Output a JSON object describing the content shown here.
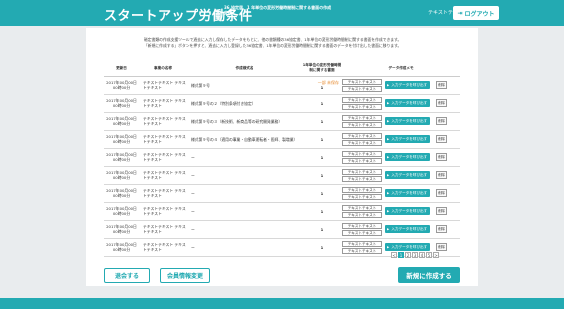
{
  "header": {
    "title": "スタートアップ労働条件",
    "subtitle": "36 協定届、1 年単位の変形労働時間制に関する書面の作成支援",
    "user_name": "テキストテキ",
    "logout_label": "ログアウト"
  },
  "description": {
    "line1": "磁定書類の作成支援ツールで過去に入力し保存したデータをもとに、他の書類種の36協定書、1年単位の変形労働時間制に関する書面を作成できます。",
    "line2": "「新規に作成する」ボタンを押すと、過去に入力し登録した36協定書、1年単位の変形労働時間制に関する書面のデータを付け出した書面に移ります。"
  },
  "table": {
    "headers": {
      "date": "更新日",
      "name": "事業の名称",
      "law": "作成様式名",
      "count": "1年単位の変形労働時間制に関する書面",
      "data_create": "データ作成メモ"
    },
    "rows": [
      {
        "date": "2017年00月00日 00時00分",
        "name": "テキストテキスト テキストテキスト",
        "law": "様式第９号",
        "remain": "一部 未保存",
        "count": "1",
        "seg1": "テキストテキスト",
        "seg2": "テキストテキスト",
        "input": "入力データを呼び出す",
        "del": "削除"
      },
      {
        "date": "2017年00月00日 00時00分",
        "name": "テキストテキスト テキストテキスト",
        "law": "様式第９号の２（特別条項付き協定）",
        "remain": "",
        "count": "1",
        "seg1": "テキストテキスト",
        "seg2": "テキストテキスト",
        "input": "入力データを呼び出す",
        "del": "削除"
      },
      {
        "date": "2017年00月00日 00時00分",
        "name": "テキストテキスト テキストテキスト",
        "law": "様式第９号の３（新技術、新商品等の研究開発業務）",
        "remain": "",
        "count": "1",
        "seg1": "テキストテキスト",
        "seg2": "テキストテキスト",
        "input": "入力データを呼び出す",
        "del": "削除"
      },
      {
        "date": "2017年00月00日 00時00分",
        "name": "テキストテキスト テキストテキスト",
        "law": "様式第９号の４（適用の事業・自動車運転者・医師、製増業）",
        "remain": "",
        "count": "1",
        "seg1": "テキストテキスト",
        "seg2": "テキストテキスト",
        "input": "入力データを呼び出す",
        "del": "削除"
      },
      {
        "date": "2017年00月00日 00時00分",
        "name": "テキストテキスト テキストテキスト",
        "law": "ー",
        "remain": "",
        "count": "1",
        "seg1": "テキストテキスト",
        "seg2": "テキストテキスト",
        "input": "入力データを呼び出す",
        "del": "削除"
      },
      {
        "date": "2017年00月00日 00時00分",
        "name": "テキストテキスト テキストテキスト",
        "law": "ー",
        "remain": "",
        "count": "1",
        "seg1": "テキストテキスト",
        "seg2": "テキストテキスト",
        "input": "入力データを呼び出す",
        "del": "削除"
      },
      {
        "date": "2017年00月00日 00時00分",
        "name": "テキストテキスト テキストテキスト",
        "law": "ー",
        "remain": "",
        "count": "1",
        "seg1": "テキストテキスト",
        "seg2": "テキストテキスト",
        "input": "入力データを呼び出す",
        "del": "削除"
      },
      {
        "date": "2017年00月00日 00時00分",
        "name": "テキストテキスト テキストテキスト",
        "law": "ー",
        "remain": "",
        "count": "1",
        "seg1": "テキストテキスト",
        "seg2": "テキストテキスト",
        "input": "入力データを呼び出す",
        "del": "削除"
      },
      {
        "date": "2017年00月00日 00時00分",
        "name": "テキストテキスト テキストテキスト",
        "law": "ー",
        "remain": "",
        "count": "1",
        "seg1": "テキストテキスト",
        "seg2": "テキストテキスト",
        "input": "入力データを呼び出す",
        "del": "削除"
      },
      {
        "date": "2017年00月00日 00時00分",
        "name": "テキストテキスト テキストテキスト",
        "law": "ー",
        "remain": "",
        "count": "1",
        "seg1": "テキストテキスト",
        "seg2": "テキストテキスト",
        "input": "入力データを呼び出す",
        "del": "削除"
      }
    ]
  },
  "pager": {
    "prev": "<",
    "pages": [
      "1",
      "2",
      "3",
      "4",
      "5"
    ],
    "next": ">",
    "active": "1"
  },
  "buttons": {
    "withdraw": "退会する",
    "member_info": "会員情報変更",
    "create_new": "新規に作成する"
  },
  "colors": {
    "accent": "#23aab2",
    "warning": "#e68a2e"
  }
}
